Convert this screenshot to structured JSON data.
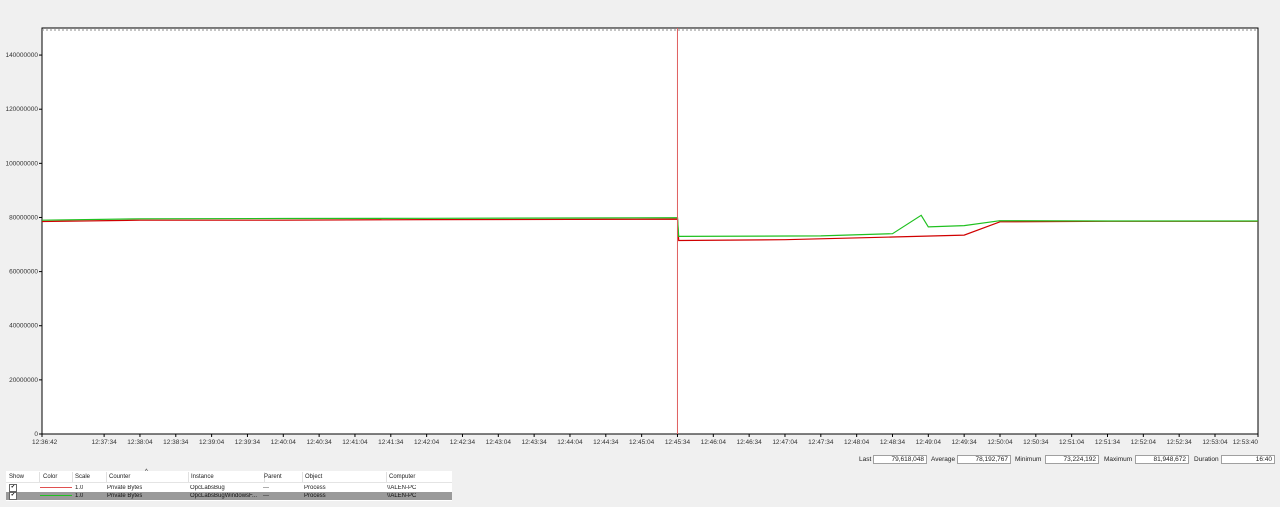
{
  "chart_data": {
    "type": "line",
    "ylim": [
      0,
      150000000
    ],
    "yticks": [
      "0",
      "20000000",
      "40000000",
      "60000000",
      "80000000",
      "100000000",
      "120000000",
      "140000000"
    ],
    "x_ticks": [
      "12:36:42",
      "12:37:34",
      "12:38:04",
      "12:38:34",
      "12:39:04",
      "12:39:34",
      "12:40:04",
      "12:40:34",
      "12:41:04",
      "12:41:34",
      "12:42:04",
      "12:42:34",
      "12:43:04",
      "12:43:34",
      "12:44:04",
      "12:44:34",
      "12:45:04",
      "12:45:34",
      "12:46:04",
      "12:46:34",
      "12:47:04",
      "12:47:34",
      "12:48:04",
      "12:48:34",
      "12:49:04",
      "12:49:34",
      "12:50:04",
      "12:50:34",
      "12:51:04",
      "12:51:34",
      "12:52:04",
      "12:52:34",
      "12:53:04",
      "12:53:40"
    ],
    "current_time_marker": "12:45:34",
    "grid": false,
    "series": [
      {
        "name": "Private Bytes",
        "instance": "OpcLabsBug",
        "color": "#d00000",
        "x": [
          "12:36:42",
          "12:38:04",
          "12:40:04",
          "12:42:04",
          "12:44:04",
          "12:45:34",
          "12:45:35",
          "12:47:04",
          "12:48:34",
          "12:49:34",
          "12:50:04",
          "12:51:34",
          "12:53:04",
          "12:53:40"
        ],
        "values": [
          78500000,
          79000000,
          79000000,
          79200000,
          79300000,
          79400000,
          71500000,
          71800000,
          72800000,
          73500000,
          78400000,
          78600000,
          78600000,
          78600000
        ]
      },
      {
        "name": "Private Bytes",
        "instance": "OpcLabsBugWindowsForms",
        "color": "#20c020",
        "x": [
          "12:36:42",
          "12:38:04",
          "12:40:04",
          "12:42:04",
          "12:44:04",
          "12:45:34",
          "12:45:35",
          "12:47:34",
          "12:48:34",
          "12:48:58",
          "12:49:04",
          "12:49:34",
          "12:50:04",
          "12:51:34",
          "12:53:04",
          "12:53:40"
        ],
        "values": [
          79000000,
          79500000,
          79600000,
          79700000,
          79800000,
          79900000,
          73000000,
          73200000,
          74000000,
          80800000,
          76500000,
          77000000,
          78800000,
          78700000,
          78700000,
          78700000
        ]
      }
    ]
  },
  "stats": {
    "last_label": "Last",
    "last_value": "79,618,048",
    "average_label": "Average",
    "average_value": "78,192,767",
    "minimum_label": "Minimum",
    "minimum_value": "73,224,192",
    "maximum_label": "Maximum",
    "maximum_value": "81,948,672",
    "duration_label": "Duration",
    "duration_value": "16:40"
  },
  "legend": {
    "headers": {
      "show": "Show",
      "color": "Color",
      "scale": "Scale",
      "counter": "Counter",
      "instance": "Instance",
      "parent": "Parent",
      "object": "Object",
      "computer": "Computer"
    },
    "rows": [
      {
        "checked": "✔",
        "color": "#e05050",
        "scale": "1.0",
        "counter": "Private Bytes",
        "instance": "OpcLabsBug",
        "parent": "---",
        "object": "Process",
        "computer": "\\\\ALEN-PC"
      },
      {
        "checked": "✔",
        "color": "#20c020",
        "scale": "1.0",
        "counter": "Private Bytes",
        "instance": "OpcLabsBugWindowsF...",
        "parent": "---",
        "object": "Process",
        "computer": "\\\\ALEN-PC"
      }
    ]
  }
}
